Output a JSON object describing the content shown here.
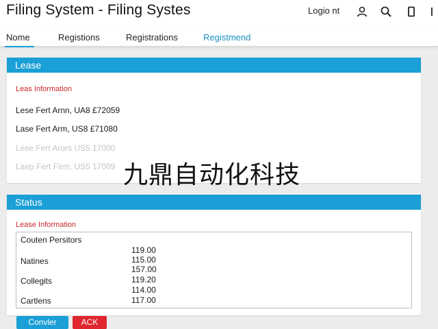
{
  "app": {
    "title": "Filing System - Filing Systes",
    "login_label": "Logio nt",
    "icons": [
      "user-icon",
      "search-icon",
      "device-icon",
      "menu-icon"
    ]
  },
  "nav": {
    "tabs": [
      {
        "label": "Nome",
        "active": true
      },
      {
        "label": "Registions",
        "active": false
      },
      {
        "label": "Registrations",
        "active": false
      },
      {
        "label": "Registmend",
        "active": false
      }
    ]
  },
  "lease_panel": {
    "header": "Lease",
    "section_label": "Leas Information",
    "lines": [
      "Lese Fert Arnn, UA8 £72059",
      "Lase Fert Arm, US8 £71080",
      "Lese Fert Arors US5 17000",
      "Laep Fert Firm, US5 17009"
    ]
  },
  "status_panel": {
    "header": "Status",
    "section_label": "Lease Information",
    "table_header": "Couten Persitors",
    "rows": [
      {
        "label": "",
        "value": "119.00"
      },
      {
        "label": "Natines",
        "value": "115.00"
      },
      {
        "label": "",
        "value": "157.00"
      },
      {
        "label": "Collegits",
        "value": "119.20"
      },
      {
        "label": "",
        "value": "114.00"
      },
      {
        "label": "Cartlens",
        "value": "117.00"
      }
    ]
  },
  "actions": {
    "primary": "Convler",
    "danger": "ACK"
  },
  "watermark": "九鼎自动化科技",
  "colors": {
    "accent": "#1a9fd6",
    "danger": "#e0262e",
    "label_red": "#c8262e"
  }
}
